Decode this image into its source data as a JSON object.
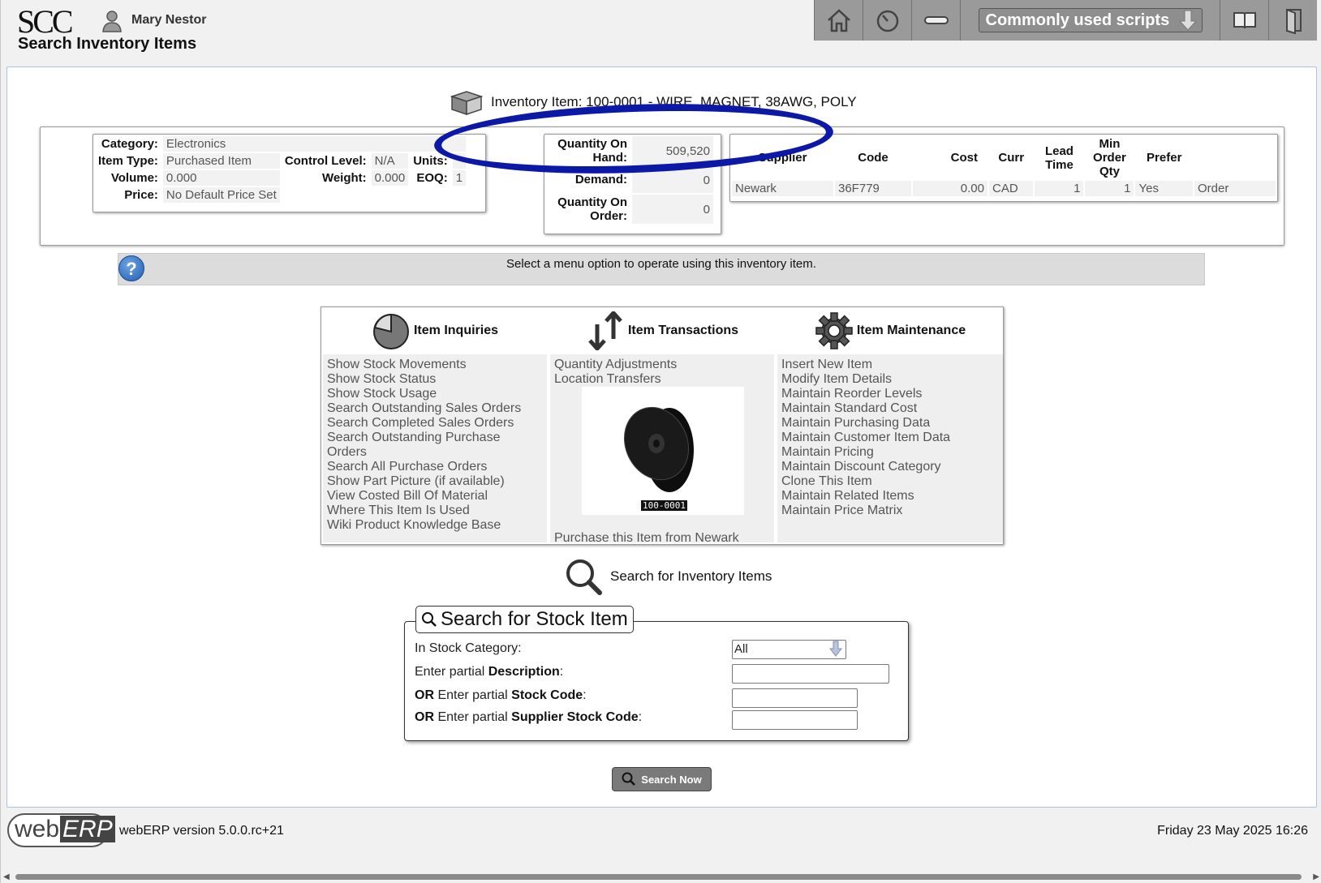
{
  "header": {
    "logo": "SCC",
    "user_name": "Mary Nestor",
    "page_title": "Search Inventory Items",
    "scripts_select": "Commonly used scripts"
  },
  "item": {
    "heading": "Inventory Item: 100-0001 - WIRE, MAGNET, 38AWG, POLY",
    "category_label": "Category:",
    "category": "Electronics",
    "item_type_label": "Item Type:",
    "item_type": "Purchased Item",
    "control_level_label": "Control Level:",
    "control_level": "N/A",
    "units_label": "Units:",
    "units": "",
    "volume_label": "Volume:",
    "volume": "0.000",
    "weight_label": "Weight:",
    "weight": "0.000",
    "eoq_label": "EOQ:",
    "eoq": "1",
    "price_label": "Price:",
    "price": "No Default Price Set"
  },
  "quantities": {
    "on_hand_label": "Quantity On Hand:",
    "on_hand": "509,520",
    "demand_label": "Demand:",
    "demand": "0",
    "on_order_label": "Quantity On Order:",
    "on_order": "0"
  },
  "suppliers": {
    "headers": [
      "Supplier",
      "Code",
      "Cost",
      "Curr",
      "Lead Time",
      "Min Order Qty",
      "Prefer",
      ""
    ],
    "rows": [
      {
        "supplier": "Newark",
        "code": "36F779",
        "cost": "0.00",
        "curr": "CAD",
        "lead": "1",
        "min_qty": "1",
        "prefer": "Yes",
        "action": "Order"
      }
    ]
  },
  "hint": "Select a menu option to operate using this inventory item.",
  "menu": {
    "inquiries": {
      "title": "Item Inquiries",
      "links": [
        "Show Stock Movements",
        "Show Stock Status",
        "Show Stock Usage",
        "Search Outstanding Sales Orders",
        "Search Completed Sales Orders",
        "Search Outstanding Purchase Orders",
        "Search All Purchase Orders",
        "Show Part Picture (if available)",
        "View Costed Bill Of Material",
        "Where This Item Is Used",
        "Wiki Product Knowledge Base"
      ]
    },
    "transactions": {
      "title": "Item Transactions",
      "links": [
        "Quantity Adjustments",
        "Location Transfers"
      ],
      "part_code": "100-0001",
      "purchase": "Purchase this Item from Newark"
    },
    "maintenance": {
      "title": "Item Maintenance",
      "links": [
        "Insert New Item",
        "Modify Item Details",
        "Maintain Reorder Levels",
        "Maintain Standard Cost",
        "Maintain Purchasing Data",
        "Maintain Customer Item Data",
        "Maintain Pricing",
        "Maintain Discount Category",
        "Clone This Item",
        "Maintain Related Items",
        "Maintain Price Matrix"
      ]
    }
  },
  "search": {
    "heading": "Search for Inventory Items",
    "legend": "Search for Stock Item",
    "category_label": "In Stock Category:",
    "category_value": "All",
    "desc_label_pre": "Enter partial ",
    "desc_label_bold": "Description",
    "code_label_or": "OR",
    "code_label_mid": " Enter partial ",
    "code_label_bold": "Stock Code",
    "supp_label_or": "OR",
    "supp_label_mid": " Enter partial ",
    "supp_label_bold": "Supplier Stock Code",
    "colon": ":",
    "button": "Search Now"
  },
  "footer": {
    "logo_web": "web",
    "logo_erp": "ERP",
    "version": "webERP version 5.0.0.rc+21",
    "datetime": "Friday 23 May 2025 16:26"
  }
}
